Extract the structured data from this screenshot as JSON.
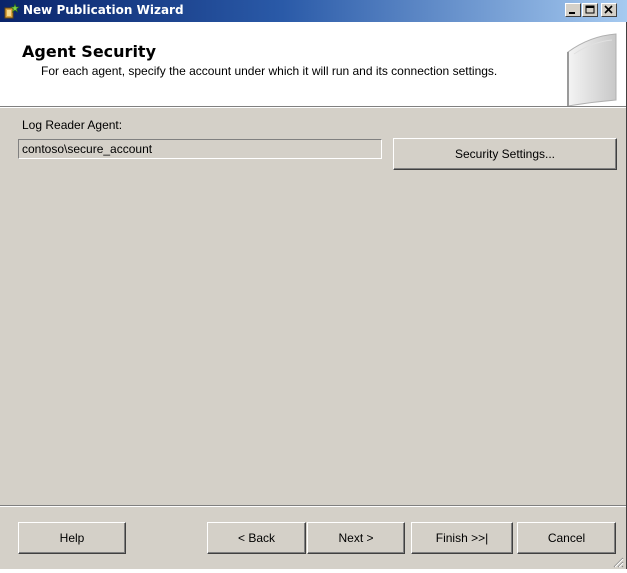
{
  "window": {
    "title": "New Publication Wizard",
    "controls": [
      "minimize-icon",
      "maximize-icon",
      "close-icon"
    ]
  },
  "header": {
    "title": "Agent Security",
    "subtitle": "For each agent, specify the account under which it will run and its connection settings."
  },
  "agent": {
    "label": "Log Reader Agent:",
    "account": "contoso\\secure_account",
    "security_button": "Security Settings..."
  },
  "footer": {
    "help": "Help",
    "back": "< Back",
    "next": "Next >",
    "finish": "Finish >>|",
    "cancel": "Cancel"
  }
}
